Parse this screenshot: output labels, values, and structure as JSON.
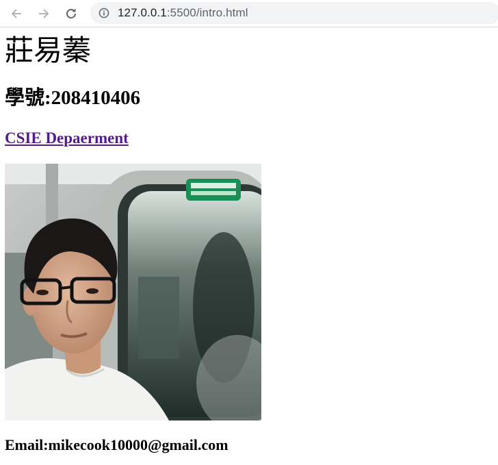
{
  "browser": {
    "url_host": "127.0.0.1",
    "url_rest": ":5500/intro.html"
  },
  "page": {
    "name": "莊易蓁",
    "student_id": "學號:208410406",
    "department_link": "CSIE Depaerment",
    "email": "Email:mikecook10000@gmail.com"
  },
  "colors": {
    "visited_link": "#551a8b",
    "omnibox_bg": "#f1f3f4"
  },
  "icons": {
    "back": "arrow-left-icon",
    "forward": "arrow-right-icon",
    "reload": "reload-icon",
    "site_info": "info-icon"
  }
}
